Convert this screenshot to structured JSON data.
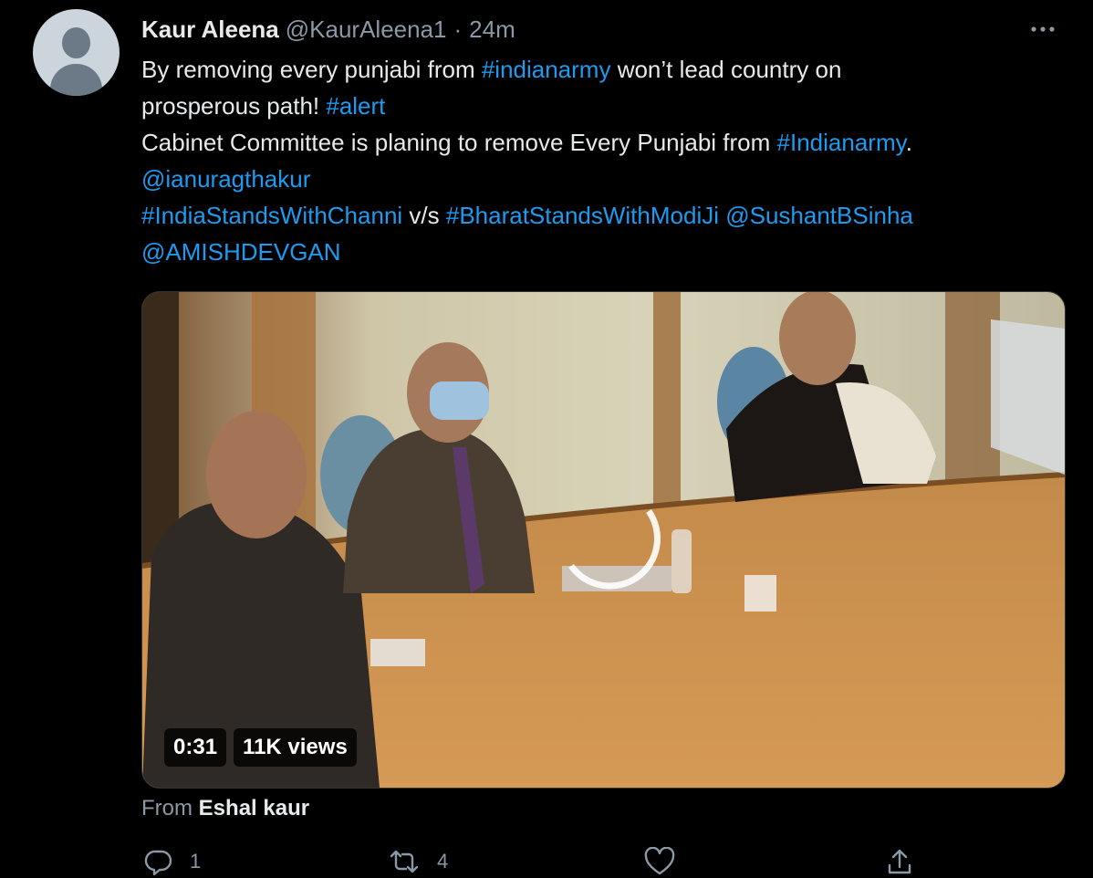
{
  "tweet": {
    "author_name": "Kaur Aleena",
    "author_handle": "@KaurAleena1",
    "separator": "·",
    "timestamp": "24m",
    "text_lines": [
      [
        {
          "t": "By removing every punjabi from ",
          "link": false
        },
        {
          "t": "#indianarmy",
          "link": true
        },
        {
          "t": " won’t lead country on",
          "link": false
        }
      ],
      [
        {
          "t": "prosperous path! ",
          "link": false
        },
        {
          "t": "#alert",
          "link": true
        }
      ],
      [
        {
          "t": "Cabinet Committee is planing to remove Every Punjabi from ",
          "link": false
        },
        {
          "t": "#Indianarmy",
          "link": true
        },
        {
          "t": ".",
          "link": false
        }
      ],
      [
        {
          "t": "@ianuragthakur",
          "link": true
        }
      ],
      [
        {
          "t": "#IndiaStandsWithChanni",
          "link": true
        },
        {
          "t": " v/s ",
          "link": false
        },
        {
          "t": "#BharatStandsWithModiJi",
          "link": true
        },
        {
          "t": " ",
          "link": false
        },
        {
          "t": "@SushantBSinha",
          "link": true
        }
      ],
      [
        {
          "t": "@AMISHDEVGAN",
          "link": true
        }
      ]
    ],
    "video": {
      "duration": "0:31",
      "views": "11K views"
    },
    "from_label": "From",
    "from_name": "Eshal kaur",
    "actions": {
      "reply_count": "1",
      "retweet_count": "4",
      "like_count": "",
      "share_count": ""
    }
  },
  "colors": {
    "background": "#000000",
    "text": "#e7e9ea",
    "secondary": "#8b98a5",
    "link": "#1d9bf0"
  },
  "icons": [
    "more-icon",
    "reply-icon",
    "retweet-icon",
    "like-icon",
    "share-icon",
    "loading-spinner-icon"
  ]
}
